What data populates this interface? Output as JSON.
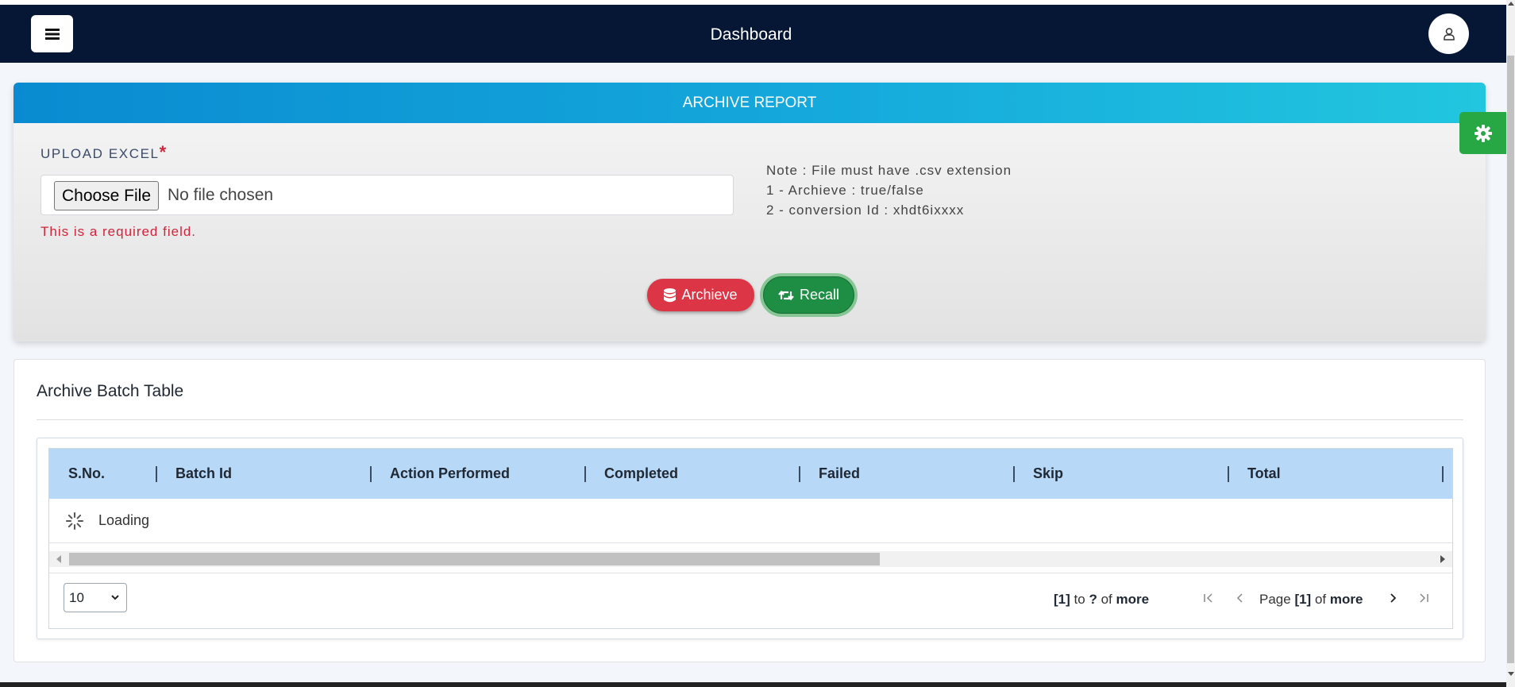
{
  "navbar": {
    "title": "Dashboard"
  },
  "upload_card": {
    "header": "ARCHIVE REPORT",
    "label": "UPLOAD EXCEL",
    "required_mark": "*",
    "choose_file_label": "Choose File",
    "file_status": "No file chosen",
    "error": "This is a required field.",
    "notes": [
      "Note : File must have .csv extension",
      "1 - Archieve : true/false",
      "2 - conversion Id : xhdt6ixxxx"
    ],
    "archive_button": "Archieve",
    "recall_button": "Recall"
  },
  "table_card": {
    "title": "Archive Batch Table",
    "columns": [
      "S.No.",
      "Batch Id",
      "Action Performed",
      "Completed",
      "Failed",
      "Skip",
      "Total"
    ],
    "loading_text": "Loading",
    "page_size": "10",
    "summary": {
      "from": "[1]",
      "to_word": "to",
      "to": "?",
      "of_word": "of",
      "total": "more"
    },
    "page": {
      "page_word": "Page",
      "current": "[1]",
      "of_word": "of",
      "total": "more"
    }
  },
  "colors": {
    "navbar_bg": "#061735",
    "header_gradient": [
      "#0a8bd1",
      "#22c6de"
    ],
    "archive_button": "#dc3545",
    "recall_button": "#1e8e44",
    "table_header": "#b7d8f7",
    "error": "#d0253a"
  },
  "icons": {
    "menu": "hamburger-icon",
    "user": "user-icon",
    "settings": "gear-icon",
    "archive": "database-icon",
    "recall": "retweet-icon",
    "loading": "spinner-icon",
    "first_page": "first-page-icon",
    "prev_page": "prev-page-icon",
    "next_page": "next-page-icon",
    "last_page": "last-page-icon"
  }
}
